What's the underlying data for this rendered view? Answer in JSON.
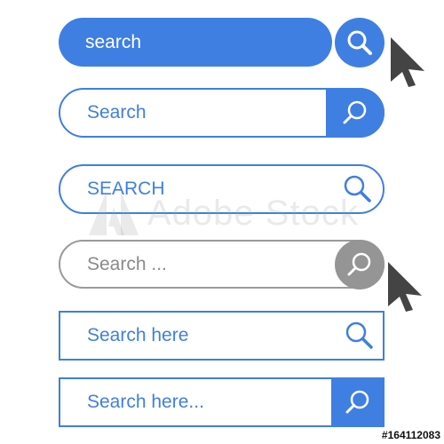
{
  "search_bars": [
    {
      "label": "search",
      "icon": "search-icon"
    },
    {
      "label": "Search",
      "icon": "search-icon"
    },
    {
      "label": "SEARCH",
      "icon": "search-icon"
    },
    {
      "label": "Search ...",
      "icon": "search-icon"
    },
    {
      "label": "Search here",
      "icon": "search-icon"
    },
    {
      "label": "Search here...",
      "icon": "search-icon"
    }
  ],
  "watermark": {
    "text": "Adobe Stock"
  },
  "stock_id": "#164112083",
  "colors": {
    "accent": "#3f7fe2",
    "grey": "#959595",
    "cursor": "#444444"
  }
}
